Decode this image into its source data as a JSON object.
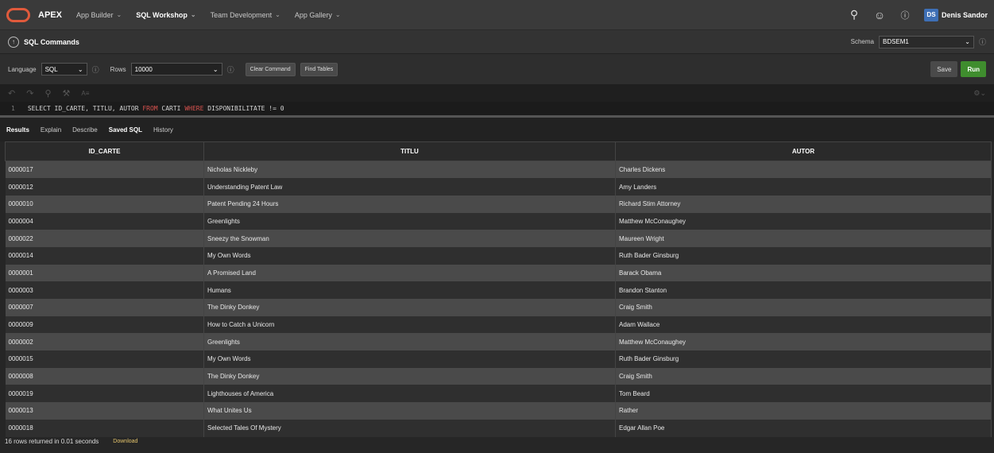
{
  "topbar": {
    "brand": "APEX",
    "nav": [
      {
        "label": "App Builder",
        "active": false
      },
      {
        "label": "SQL Workshop",
        "active": true
      },
      {
        "label": "Team Development",
        "active": false
      },
      {
        "label": "App Gallery",
        "active": false
      }
    ],
    "user_initials": "DS",
    "user_name": "Denis Sandor",
    "icons": [
      "search-icon",
      "user-share-icon",
      "help-icon"
    ]
  },
  "titlebar": {
    "title": "SQL Commands",
    "schema_label": "Schema",
    "schema_value": "BDSEM1"
  },
  "toolbar": {
    "language_label": "Language",
    "language_value": "SQL",
    "rows_label": "Rows",
    "rows_value": "10000",
    "clear_label": "Clear Command",
    "find_label": "Find Tables",
    "save_label": "Save",
    "run_label": "Run"
  },
  "editor": {
    "line_number": "1",
    "sql": {
      "p1": "SELECT ID_CARTE, TITLU, AUTOR ",
      "kw1": "FROM",
      "p2": " CARTI ",
      "kw2": "WHERE",
      "p3": " DISPONIBILITATE != 0"
    }
  },
  "tabs": [
    {
      "label": "Results",
      "active": true
    },
    {
      "label": "Explain",
      "active": false
    },
    {
      "label": "Describe",
      "active": false
    },
    {
      "label": "Saved SQL",
      "active": false
    },
    {
      "label": "History",
      "active": false
    }
  ],
  "results": {
    "columns": [
      "ID_CARTE",
      "TITLU",
      "AUTOR"
    ],
    "rows": [
      [
        "0000017",
        "Nicholas Nickleby",
        "Charles Dickens"
      ],
      [
        "0000012",
        "Understanding Patent Law",
        "Amy Landers"
      ],
      [
        "0000010",
        "Patent Pending 24 Hours",
        "Richard Stim Attorney"
      ],
      [
        "0000004",
        "Greenlights",
        "Matthew McConaughey"
      ],
      [
        "0000022",
        "Sneezy the Snowman",
        "Maureen Wright"
      ],
      [
        "0000014",
        "My Own Words",
        "Ruth Bader Ginsburg"
      ],
      [
        "0000001",
        "A Promised Land",
        "Barack Obama"
      ],
      [
        "0000003",
        "Humans",
        "Brandon Stanton"
      ],
      [
        "0000007",
        "The Dinky Donkey",
        "Craig Smith"
      ],
      [
        "0000009",
        "How to Catch a Unicorn",
        "Adam Wallace"
      ],
      [
        "0000002",
        "Greenlights",
        "Matthew McConaughey"
      ],
      [
        "0000015",
        "My Own Words",
        "Ruth Bader Ginsburg"
      ],
      [
        "0000008",
        "The Dinky Donkey",
        "Craig Smith"
      ],
      [
        "0000019",
        "Lighthouses of America",
        "Tom Beard"
      ],
      [
        "0000013",
        "What Unites Us",
        "Rather"
      ],
      [
        "0000018",
        "Selected Tales Of Mystery",
        "Edgar Allan Poe"
      ]
    ],
    "status": "16 rows returned in 0.01 seconds",
    "download": "Download"
  }
}
